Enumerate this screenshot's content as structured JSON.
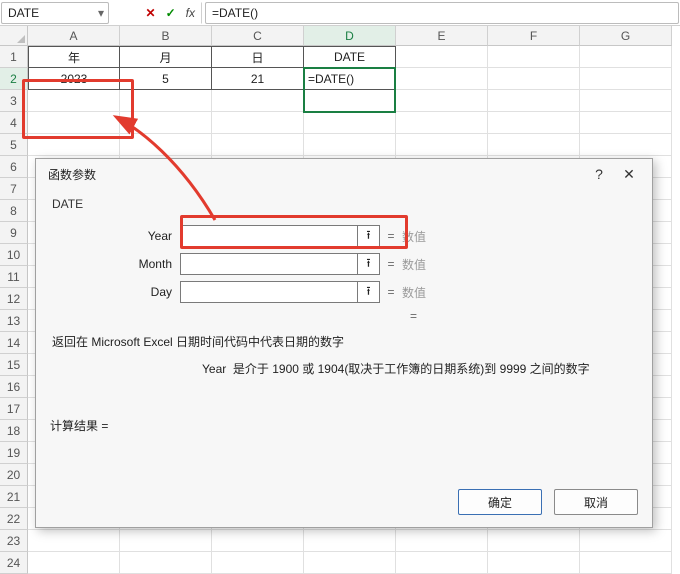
{
  "namebox": {
    "value": "DATE"
  },
  "fx": {
    "cancel_glyph": "✕",
    "accept_glyph": "✓",
    "fx_label": "fx"
  },
  "formula": {
    "text": "=DATE()"
  },
  "columns": [
    "A",
    "B",
    "C",
    "D",
    "E",
    "F",
    "G"
  ],
  "rows": [
    "1",
    "2",
    "3",
    "4",
    "5",
    "6",
    "7",
    "8",
    "9",
    "10",
    "11",
    "12",
    "13",
    "14",
    "15",
    "16",
    "17",
    "18",
    "19",
    "20",
    "21",
    "22",
    "23",
    "24"
  ],
  "table": {
    "headers": {
      "A": "年",
      "B": "月",
      "C": "日",
      "D": "DATE"
    },
    "row2": {
      "A": "2023",
      "B": "5",
      "C": "21",
      "D": "=DATE()"
    }
  },
  "dialog": {
    "title": "函数参数",
    "help": "?",
    "close": "✕",
    "func": "DATE",
    "args": [
      {
        "label": "Year",
        "value": "",
        "result": "数值"
      },
      {
        "label": "Month",
        "value": "",
        "result": "数值"
      },
      {
        "label": "Day",
        "value": "",
        "result": "数值"
      }
    ],
    "eq": "=",
    "upglyph": "⭱",
    "desc": "返回在 Microsoft Excel 日期时间代码中代表日期的数字",
    "arg_desc_label": "Year",
    "arg_desc_text": "是介于 1900 或 1904(取决于工作簿的日期系统)到 9999 之间的数字",
    "result_label": "计算结果 =",
    "ok": "确定",
    "cancel": "取消"
  }
}
